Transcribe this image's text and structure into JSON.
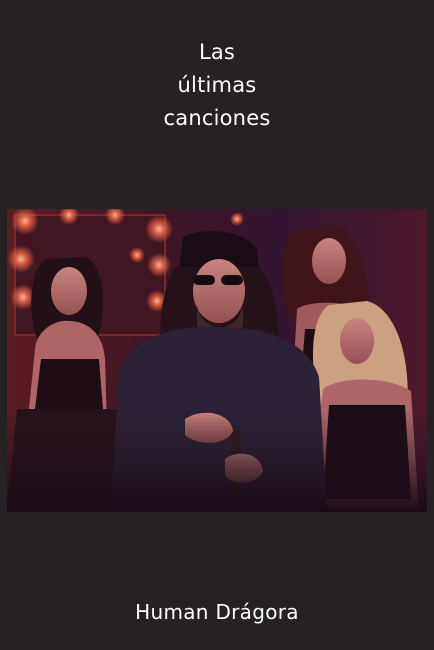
{
  "cover": {
    "title_lines": [
      "Las",
      "últimas",
      "canciones"
    ],
    "author": "Human Drágora"
  },
  "colors": {
    "background": "#262223",
    "text": "#ffffff",
    "artwork_glow": "#e2463a",
    "artwork_shadow": "#1a1016"
  }
}
